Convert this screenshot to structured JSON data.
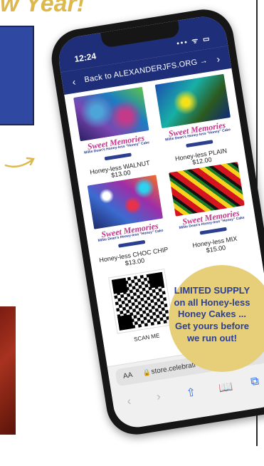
{
  "headline": "w Year!",
  "phone": {
    "status": {
      "time": "12:24",
      "icons": "••• ᯤ ▭"
    },
    "nav": {
      "back_link": "Back to ALEXANDERJFS.ORG →"
    },
    "products": [
      {
        "brand": "Sweet Memories",
        "brand_sub": "Millie Dean's Honey-less \"Honey\" Cake",
        "name": "Honey-less WALNUT",
        "price": "$13.00"
      },
      {
        "brand": "Sweet Memories",
        "brand_sub": "Millie Dean's Honey-less \"Honey\" Cake",
        "name": "Honey-less PLAIN",
        "price": "$12.00"
      },
      {
        "brand": "Sweet Memories",
        "brand_sub": "Millie Dean's Honey-less \"Honey\" Cake",
        "name": "Honey-less CHOC CHIP",
        "price": "$13.00"
      },
      {
        "brand": "Sweet Memories",
        "brand_sub": "Millie Dean's Honey-less \"Honey\" Cake",
        "name": "Honey-less MIX",
        "price": "$15.00"
      }
    ],
    "qr": {
      "label": "SCAN ME"
    },
    "browser": {
      "text_size": "AA",
      "url": "store.celebrati"
    }
  },
  "badge": {
    "lines": [
      "LIMITED SUPPLY",
      "on all Honey-less",
      "Honey Cakes ...",
      "Get yours before",
      "we run out!"
    ]
  },
  "colors": {
    "gold": "#ddb84c",
    "navy": "#1f2e78",
    "badge": "#e6cf78",
    "badge_text": "#2c3f92"
  }
}
